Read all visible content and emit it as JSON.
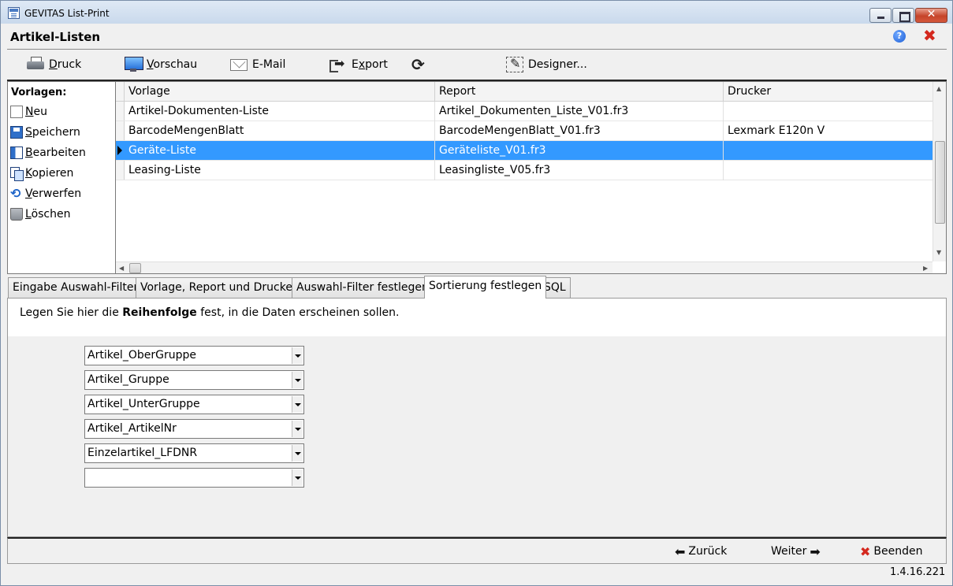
{
  "window": {
    "title": "GEVITAS List-Print"
  },
  "form": {
    "title": "Artikel-Listen",
    "help_symbol": "?",
    "close_symbol": "✖"
  },
  "toolbar": {
    "print": {
      "first": "D",
      "rest": "ruck"
    },
    "preview": {
      "first": "V",
      "rest": "orschau"
    },
    "email": {
      "label": "E-Mail"
    },
    "export": {
      "pre": "E",
      "underline": "x",
      "rest": "port"
    },
    "refresh_symbol": "⟳",
    "designer": {
      "label": "Designer..."
    }
  },
  "vorlagen": {
    "title": "Vorlagen:",
    "items": [
      {
        "first": "N",
        "rest": "eu"
      },
      {
        "first": "S",
        "rest": "peichern"
      },
      {
        "first": "B",
        "rest": "earbeiten"
      },
      {
        "first": "K",
        "rest": "opieren"
      },
      {
        "first": "V",
        "rest": "erwerfen"
      },
      {
        "first": "L",
        "rest": "öschen"
      }
    ]
  },
  "grid": {
    "columns": [
      "Vorlage",
      "Report",
      "Drucker"
    ],
    "rows": [
      {
        "vorlage": "Artikel-Dokumenten-Liste",
        "report": "Artikel_Dokumenten_Liste_V01.fr3",
        "drucker": ""
      },
      {
        "vorlage": "BarcodeMengenBlatt",
        "report": "BarcodeMengenBlatt_V01.fr3",
        "drucker": "Lexmark E120n V"
      },
      {
        "vorlage": "Geräte-Liste",
        "report": "Geräteliste_V01.fr3",
        "drucker": ""
      },
      {
        "vorlage": "Leasing-Liste",
        "report": "Leasingliste_V05.fr3",
        "drucker": ""
      }
    ],
    "selected_row": 2
  },
  "tabs": [
    {
      "label": "Eingabe Auswahl-Filter"
    },
    {
      "label": "Vorlage, Report und Drucker"
    },
    {
      "label": "Auswahl-Filter festlegen"
    },
    {
      "label": "Sortierung festlegen"
    },
    {
      "label": "SQL"
    }
  ],
  "active_tab": 3,
  "sort_panel": {
    "instruction_pre": "Legen Sie hier die ",
    "instruction_bold": "Reihenfolge",
    "instruction_post": " fest, in die Daten erscheinen sollen.",
    "sort_fields": [
      "Artikel_OberGruppe",
      "Artikel_Gruppe",
      "Artikel_UnterGruppe",
      "Artikel_ArtikelNr",
      "Einzelartikel_LFDNR",
      ""
    ]
  },
  "footer": {
    "back_label": "Zurück",
    "next_label": "Weiter",
    "quit_label": "Beenden",
    "version": "1.4.16.221"
  }
}
